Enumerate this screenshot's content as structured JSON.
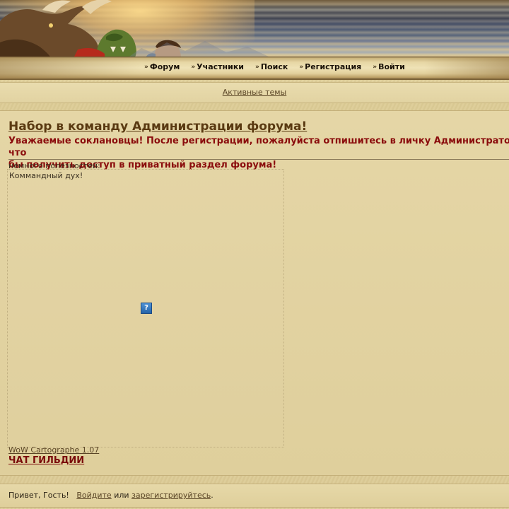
{
  "header": {
    "banner_alt": "World of Warcraft header artwork"
  },
  "nav": {
    "items": [
      {
        "label": "Форум",
        "icon": "double-chevron-right-icon"
      },
      {
        "label": "Участники",
        "icon": "double-chevron-right-icon"
      },
      {
        "label": "Поиск",
        "icon": "double-chevron-right-icon"
      },
      {
        "label": "Регистрация",
        "icon": "double-chevron-right-icon"
      },
      {
        "label": "Войти",
        "icon": "double-chevron-right-icon"
      }
    ]
  },
  "active_topics": {
    "label": "Активные темы"
  },
  "announcement": {
    "title": "Набор в команду Администрации форума!",
    "subtitle_line1": "Уважаемые сокланoвцы! После регистрации, пожалуйста отпишитесь в личку Администратора, что",
    "subtitle_line2": "бы получить доступ в приватный раздел форума!",
    "useful_label": "немного полезностей:",
    "frame_caption": "Коммандный дух!",
    "broken_image_glyph": "?",
    "cartographer_link": "WoW Cartographe 1.07",
    "chat_link": "ЧАТ ГИЛЬДИИ"
  },
  "greeting": {
    "hello": "Привет, Гость!",
    "login_link": "Войдите",
    "or": "или",
    "register_link": "зарегистрируйтесь",
    "period": "."
  },
  "colors": {
    "title": "#5a3a12",
    "subtitle": "#8a0c0c",
    "link": "#5a4526",
    "chat_link": "#7a0a0a"
  }
}
